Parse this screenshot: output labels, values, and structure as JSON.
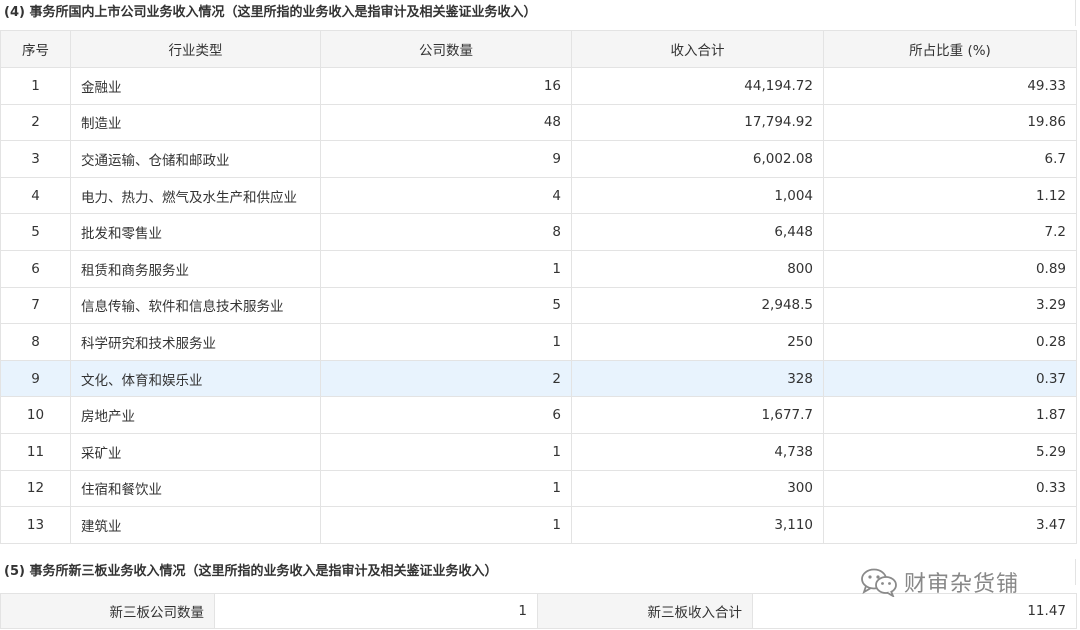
{
  "section4": {
    "title": "(4) 事务所国内上市公司业务收入情况（这里所指的业务收入是指审计及相关鉴证业务收入）",
    "headers": [
      "序号",
      "行业类型",
      "公司数量",
      "收入合计",
      "所占比重 (%)"
    ],
    "rows": [
      [
        "1",
        "金融业",
        "16",
        "44,194.72",
        "49.33"
      ],
      [
        "2",
        "制造业",
        "48",
        "17,794.92",
        "19.86"
      ],
      [
        "3",
        "交通运输、仓储和邮政业",
        "9",
        "6,002.08",
        "6.7"
      ],
      [
        "4",
        "电力、热力、燃气及水生产和供应业",
        "4",
        "1,004",
        "1.12"
      ],
      [
        "5",
        "批发和零售业",
        "8",
        "6,448",
        "7.2"
      ],
      [
        "6",
        "租赁和商务服务业",
        "1",
        "800",
        "0.89"
      ],
      [
        "7",
        "信息传输、软件和信息技术服务业",
        "5",
        "2,948.5",
        "3.29"
      ],
      [
        "8",
        "科学研究和技术服务业",
        "1",
        "250",
        "0.28"
      ],
      [
        "9",
        "文化、体育和娱乐业",
        "2",
        "328",
        "0.37"
      ],
      [
        "10",
        "房地产业",
        "6",
        "1,677.7",
        "1.87"
      ],
      [
        "11",
        "采矿业",
        "1",
        "4,738",
        "5.29"
      ],
      [
        "12",
        "住宿和餐饮业",
        "1",
        "300",
        "0.33"
      ],
      [
        "13",
        "建筑业",
        "1",
        "3,110",
        "3.47"
      ]
    ],
    "highlight_row_index": 8,
    "highlight_color": "#e8f3fd"
  },
  "section5": {
    "title": "(5) 事务所新三板业务收入情况（这里所指的业务收入是指审计及相关鉴证业务收入）",
    "company_count_label": "新三板公司数量",
    "company_count_value": "1",
    "income_label": "新三板收入合计",
    "income_value": "11.47"
  },
  "watermark": {
    "icon": "wechat-icon",
    "text": "财审杂货铺"
  }
}
